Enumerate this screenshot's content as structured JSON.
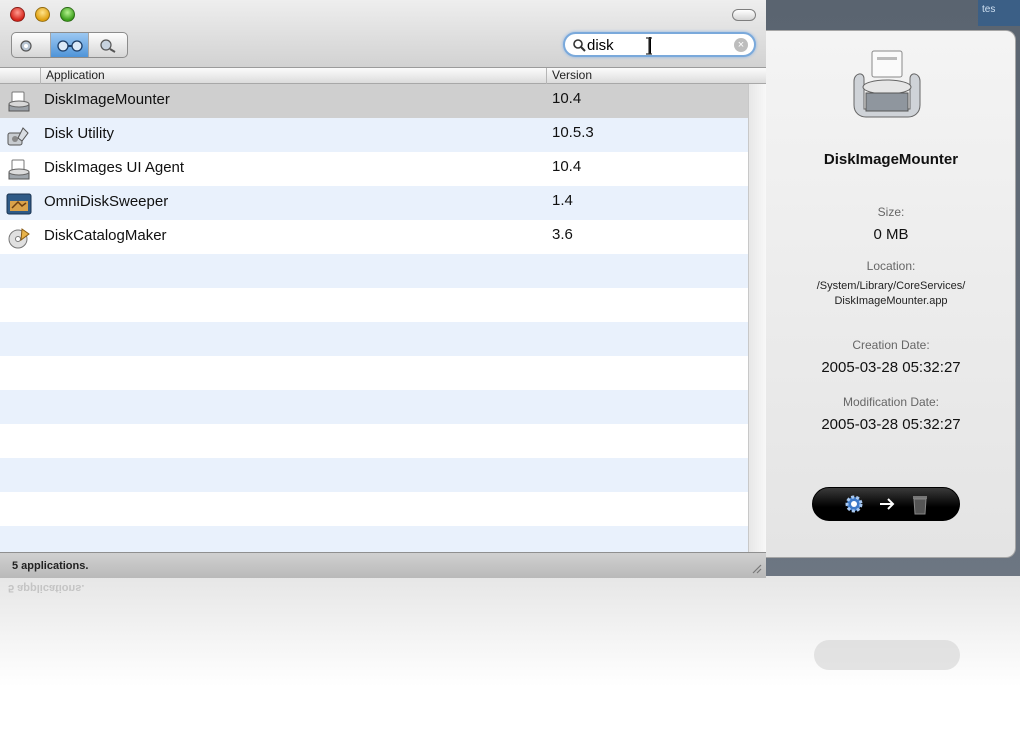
{
  "desktop": {
    "corner_text": "tes"
  },
  "window": {
    "search": {
      "value": "disk",
      "placeholder": ""
    },
    "columns": {
      "application": "Application",
      "version": "Version"
    },
    "rows": [
      {
        "name": "DiskImageMounter",
        "version": "10.4",
        "icon": "disk-image-mounter-icon",
        "selected": true
      },
      {
        "name": "Disk Utility",
        "version": "10.5.3",
        "icon": "disk-utility-icon",
        "selected": false
      },
      {
        "name": "DiskImages UI Agent",
        "version": "10.4",
        "icon": "disk-images-agent-icon",
        "selected": false
      },
      {
        "name": "OmniDiskSweeper",
        "version": "1.4",
        "icon": "omni-disk-sweeper-icon",
        "selected": false
      },
      {
        "name": "DiskCatalogMaker",
        "version": "3.6",
        "icon": "disk-catalog-maker-icon",
        "selected": false
      }
    ],
    "status": "5 applications."
  },
  "info": {
    "title": "DiskImageMounter",
    "size_label": "Size:",
    "size_value": "0 MB",
    "location_label": "Location:",
    "location_line1": "/System/Library/CoreServices/",
    "location_line2": "DiskImageMounter.app",
    "created_label": "Creation Date:",
    "created_value": "2005-03-28 05:32:27",
    "modified_label": "Modification Date:",
    "modified_value": "2005-03-28 05:32:27"
  },
  "reflection": {
    "status": "5 applications."
  },
  "colors": {
    "selected_row": "#cfcfcf",
    "alt_row": "#e9f1fc",
    "accent": "#4f94d8"
  }
}
